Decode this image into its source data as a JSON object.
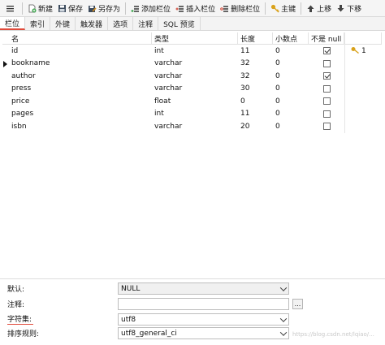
{
  "toolbar": {
    "menu_icon": "hamburger-icon",
    "new_label": "新建",
    "save_label": "保存",
    "save_as_label": "另存为",
    "add_field_label": "添加栏位",
    "insert_field_label": "插入栏位",
    "delete_field_label": "删除栏位",
    "primary_key_label": "主键",
    "move_up_label": "上移",
    "move_down_label": "下移"
  },
  "tabs": [
    "栏位",
    "索引",
    "外键",
    "触发器",
    "选项",
    "注释",
    "SQL 预览"
  ],
  "columns_header": {
    "name": "名",
    "type": "类型",
    "length": "长度",
    "decimals": "小数点",
    "not_null": "不是 null"
  },
  "fields": [
    {
      "name": "id",
      "type": "int",
      "length": "11",
      "decimals": "0",
      "not_null": true,
      "key": "1"
    },
    {
      "name": "bookname",
      "type": "varchar",
      "length": "32",
      "decimals": "0",
      "not_null": false,
      "key": ""
    },
    {
      "name": "author",
      "type": "varchar",
      "length": "32",
      "decimals": "0",
      "not_null": true,
      "key": ""
    },
    {
      "name": "press",
      "type": "varchar",
      "length": "30",
      "decimals": "0",
      "not_null": false,
      "key": ""
    },
    {
      "name": "price",
      "type": "float",
      "length": "0",
      "decimals": "0",
      "not_null": false,
      "key": ""
    },
    {
      "name": "pages",
      "type": "int",
      "length": "11",
      "decimals": "0",
      "not_null": false,
      "key": ""
    },
    {
      "name": "isbn",
      "type": "varchar",
      "length": "20",
      "decimals": "0",
      "not_null": false,
      "key": ""
    }
  ],
  "properties": {
    "default_label": "默认:",
    "default_value": "NULL",
    "comment_label": "注释:",
    "comment_value": "",
    "comment_button": "...",
    "charset_label": "字符集:",
    "charset_value": "utf8",
    "collation_label": "排序规则:",
    "collation_value": "utf8_general_ci"
  },
  "watermark": "https://blog.csdn.net/lqiao/...",
  "colors": {
    "accent_red": "#e04a3a",
    "key_gold": "#d9a21b"
  }
}
